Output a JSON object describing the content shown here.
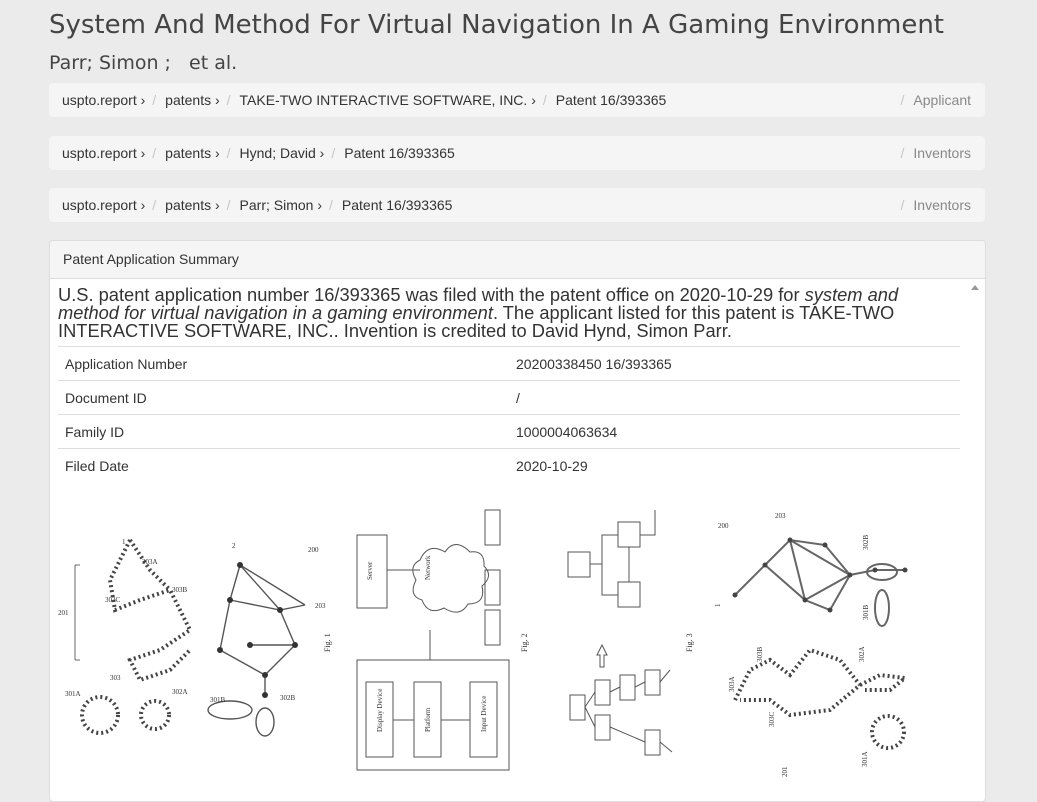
{
  "title": "System And Method For Virtual Navigation In A Gaming Environment",
  "authors": "Parr; Simon ;   et al.",
  "breadcrumbs": [
    {
      "items": [
        "uspto.report ›",
        "patents ›",
        "TAKE-TWO INTERACTIVE SOFTWARE, INC. ›",
        "Patent 16/393365"
      ],
      "right": "Applicant"
    },
    {
      "items": [
        "uspto.report ›",
        "patents ›",
        "Hynd; David ›",
        "Patent 16/393365"
      ],
      "right": "Inventors"
    },
    {
      "items": [
        "uspto.report ›",
        "patents ›",
        "Parr; Simon ›",
        "Patent 16/393365"
      ],
      "right": "Inventors"
    }
  ],
  "separator": "/",
  "panel": {
    "heading": "Patent Application Summary",
    "summary_pre": "U.S. patent application number 16/393365 was filed with the patent office on 2020-10-29 for ",
    "summary_em": "system and method for virtual navigation in a gaming environment",
    "summary_post": ". The applicant listed for this patent is TAKE-TWO INTERACTIVE SOFTWARE, INC.. Invention is credited to David Hynd, Simon Parr.",
    "rows": [
      {
        "label": "Application Number",
        "value": "20200338450 16/393365"
      },
      {
        "label": "Document ID",
        "value": "/"
      },
      {
        "label": "Family ID",
        "value": "1000004063634"
      },
      {
        "label": "Filed Date",
        "value": "2020-10-29"
      }
    ]
  },
  "figure_labels": {
    "fig1_node1": "1",
    "fig1_node2": "2",
    "fig2_label": "200",
    "l303A": "303A",
    "l303B": "303B",
    "l303C": "303C",
    "l201": "201",
    "l303": "303",
    "l301A": "301A",
    "l302A": "302A",
    "l301B": "301B",
    "l302B": "302B",
    "l203": "203",
    "fig_1": "Fig. 1",
    "fig_2": "Fig. 2",
    "fig_3": "Fig. 3",
    "server": "Server",
    "network": "Network",
    "display": "Display Device",
    "platform": "Platform",
    "input": "Input Device",
    "l1": "1",
    "l200b": "200",
    "l203b": "203",
    "l302B2": "302B",
    "l301B2": "301B",
    "l303A2": "303A",
    "l303B2": "303B",
    "l303C2": "303C",
    "l302A2": "302A",
    "l301A2": "301A",
    "l201b": "201"
  },
  "colors": {
    "background": "#ebebeb",
    "crumb_bg": "#f5f5f5",
    "panel_border": "#dddddd"
  }
}
